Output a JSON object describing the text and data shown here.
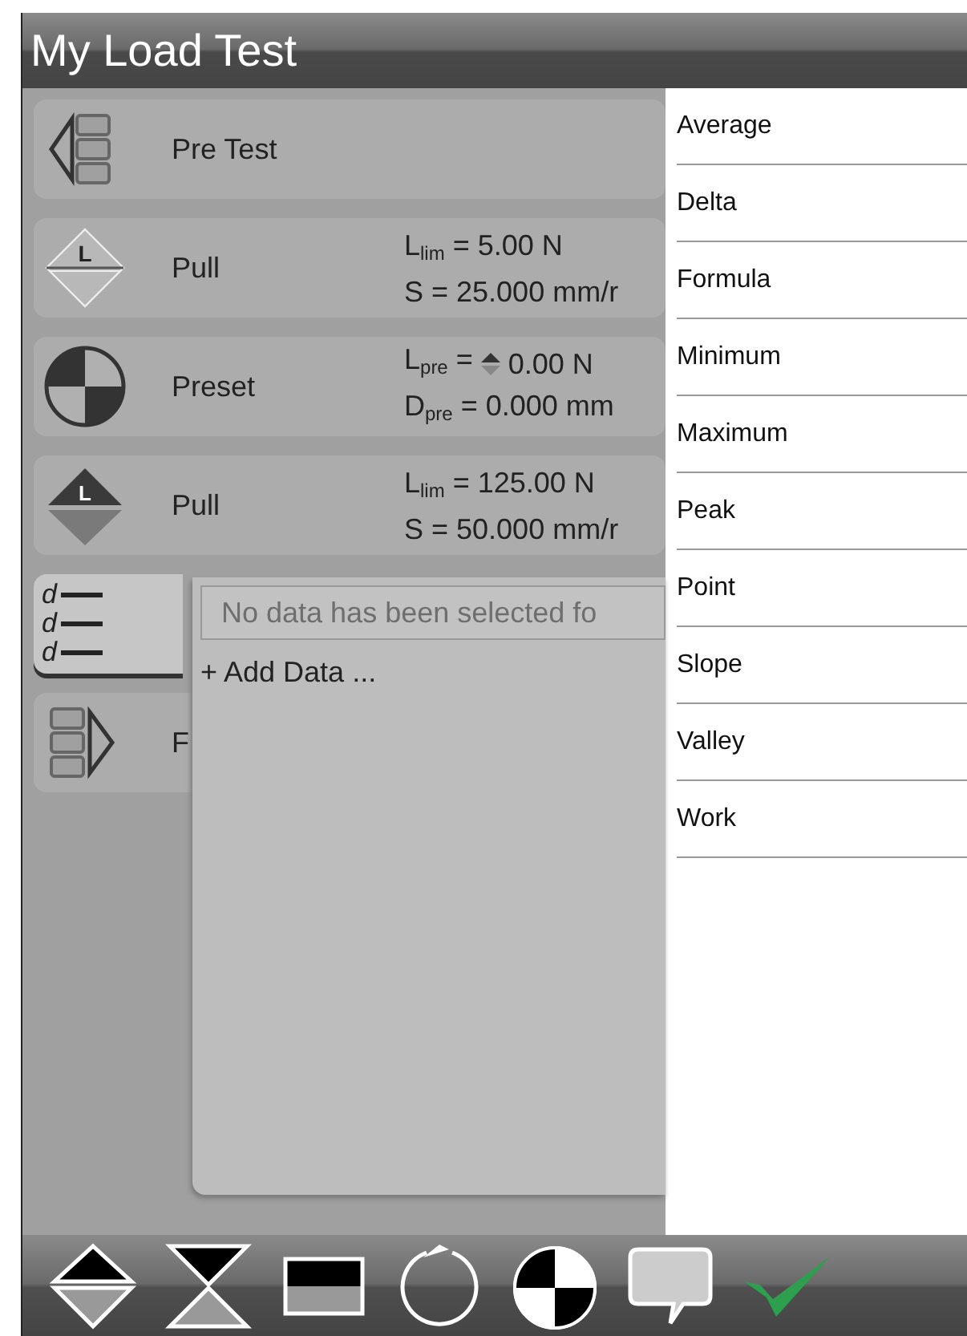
{
  "window": {
    "title": "My Load Test"
  },
  "steps": [
    {
      "kind": "pretest",
      "label": "Pre Test"
    },
    {
      "kind": "pull-outline",
      "icon_label": [
        "L"
      ],
      "label": "Pull",
      "details": [
        {
          "kind": "text",
          "text": "L$_{lim}$ = 5.00 N"
        },
        {
          "kind": "text",
          "text": "S = 25.000 mm/r"
        }
      ]
    },
    {
      "kind": "preset",
      "label": "Preset",
      "details": [
        {
          "kind": "stepper",
          "text": "L$_{pre}$ =",
          "value": "0.00 N"
        },
        {
          "kind": "text",
          "text": "D$_{pre}$ = 0.000 mm"
        }
      ]
    },
    {
      "kind": "pull-filled",
      "icon_label": [
        "L"
      ],
      "label": "Pull",
      "details": [
        {
          "kind": "text",
          "text": "L$_{lim}$ = 125.00 N"
        },
        {
          "kind": "text",
          "text": "S = 50.000 mm/r"
        }
      ]
    },
    {
      "kind": "data",
      "icon_label": [
        "d",
        "d",
        "d"
      ],
      "expanded": true,
      "popup": {
        "placeholder": "No data has been selected fo",
        "add_link": "+ Add Data ..."
      }
    },
    {
      "kind": "posttest",
      "label": "F"
    }
  ],
  "menu": {
    "items": [
      {
        "label": "Average"
      },
      {
        "label": "Delta"
      },
      {
        "label": "Formula"
      },
      {
        "label": "Minimum"
      },
      {
        "label": "Maximum"
      },
      {
        "label": "Peak"
      },
      {
        "label": "Point"
      },
      {
        "label": "Slope"
      },
      {
        "label": "Valley"
      },
      {
        "label": "Work"
      }
    ]
  },
  "toolbar": [
    {
      "kind": "pull"
    },
    {
      "kind": "compress"
    },
    {
      "kind": "hold"
    },
    {
      "kind": "cycle"
    },
    {
      "kind": "preset"
    },
    {
      "kind": "comment"
    },
    {
      "kind": "confirm"
    }
  ]
}
